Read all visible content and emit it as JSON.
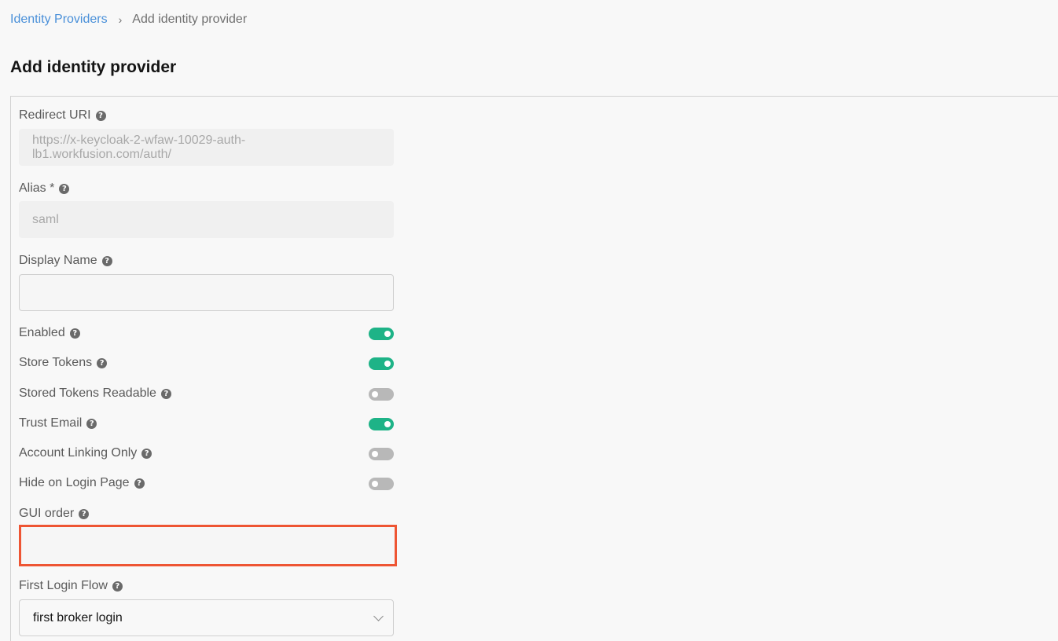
{
  "breadcrumb": {
    "parent": "Identity Providers",
    "separator": "›",
    "current": "Add identity provider"
  },
  "page_title": "Add identity provider",
  "fields": {
    "redirect_uri": {
      "label": "Redirect URI",
      "value": "https://x-keycloak-2-wfaw-10029-auth-lb1.workfusion.com/auth/"
    },
    "alias": {
      "label": "Alias *",
      "value": "saml"
    },
    "display_name": {
      "label": "Display Name",
      "value": ""
    },
    "gui_order": {
      "label": "GUI order",
      "value": ""
    },
    "first_login_flow": {
      "label": "First Login Flow",
      "selected": "first broker login"
    }
  },
  "toggles": {
    "enabled": {
      "label": "Enabled",
      "on": true
    },
    "store_tokens": {
      "label": "Store Tokens",
      "on": true
    },
    "stored_tokens_readable": {
      "label": "Stored Tokens Readable",
      "on": false
    },
    "trust_email": {
      "label": "Trust Email",
      "on": true
    },
    "account_linking_only": {
      "label": "Account Linking Only",
      "on": false
    },
    "hide_on_login_page": {
      "label": "Hide on Login Page",
      "on": false
    }
  },
  "help_icon_glyph": "?",
  "colors": {
    "toggle_on": "#1eb387",
    "toggle_off": "#b8b8b8",
    "highlight": "#ee5533",
    "link": "#4a90d9"
  }
}
